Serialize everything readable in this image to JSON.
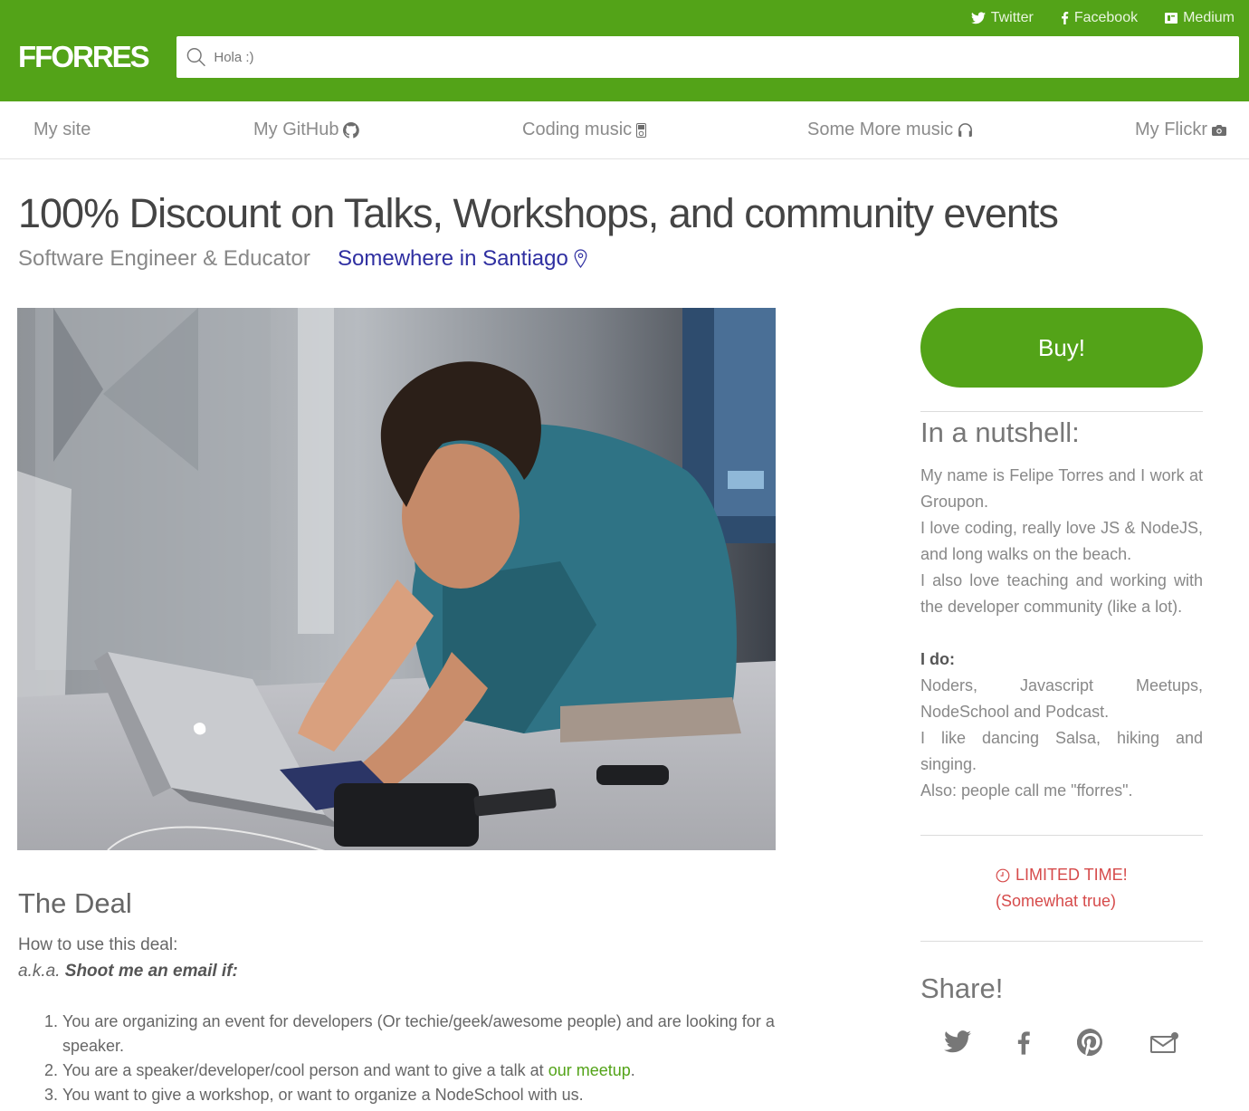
{
  "header": {
    "logo": "FFORRES",
    "search_placeholder": "Hola :)",
    "social": [
      {
        "label": "Twitter",
        "icon": "twitter-icon"
      },
      {
        "label": "Facebook",
        "icon": "facebook-icon"
      },
      {
        "label": "Medium",
        "icon": "medium-icon"
      }
    ]
  },
  "nav": {
    "items": [
      {
        "label": "My site"
      },
      {
        "label": "My GitHub",
        "icon": "github-icon"
      },
      {
        "label": "Coding music",
        "icon": "music-player-icon"
      },
      {
        "label": "Some More music",
        "icon": "headphones-icon"
      },
      {
        "label": "My Flickr",
        "icon": "camera-icon"
      }
    ]
  },
  "main": {
    "title": "100% Discount on Talks, Workshops, and community events",
    "subtitle": "Software Engineer & Educator",
    "location": "Somewhere in Santiago",
    "deal": {
      "heading": "The Deal",
      "howto": "How to use this deal:",
      "aka_prefix": "a.k.a.",
      "aka_bold": "Shoot me an email if:",
      "items": [
        {
          "num": "1.",
          "text": "You are organizing an event for developers (Or techie/geek/awesome people) and are looking for a speaker."
        },
        {
          "num": "2.",
          "text": "You are a speaker/developer/cool person and want to give a talk at ",
          "link": "our meetup",
          "suffix": "."
        },
        {
          "num": "3.",
          "text": "You want to give a workshop, or want to organize a NodeSchool with us."
        }
      ]
    }
  },
  "sidebar": {
    "buy_label": "Buy!",
    "nutshell_heading": "In a nutshell:",
    "about": [
      "My name is Felipe Torres and I work at Groupon.",
      "I love coding, really love JS & NodeJS, and long walks on the beach.",
      "I also love teaching and working with the developer community (like a lot)."
    ],
    "ido_heading": "I do:",
    "ido": [
      "Noders, Javascript Meetups, NodeSchool and Podcast.",
      "I like dancing Salsa, hiking and singing.",
      "Also: people call me \"fforres\"."
    ],
    "limited_line1": "LIMITED TIME!",
    "limited_line2": "(Somewhat true)",
    "share_heading": "Share!",
    "share_icons": [
      "twitter-icon",
      "facebook-icon",
      "pinterest-icon",
      "email-icon"
    ]
  },
  "colors": {
    "brand_green": "#53a318",
    "link_blue": "#2f2fa1",
    "alert_red": "#d64b4b"
  }
}
